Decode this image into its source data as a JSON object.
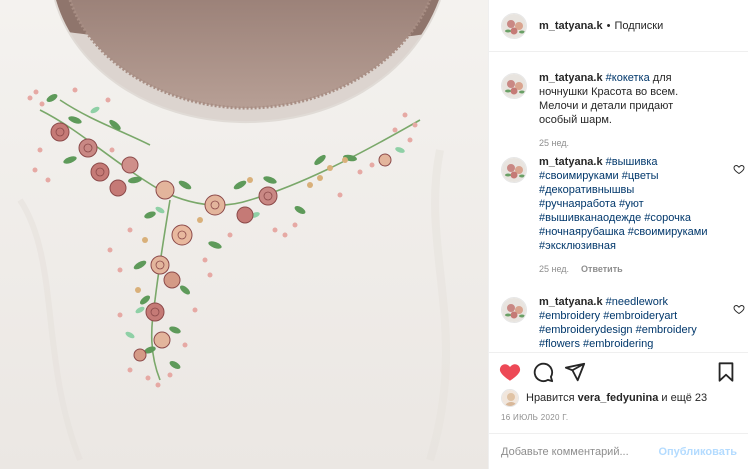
{
  "header": {
    "username": "m_tatyana.k",
    "separator": "•",
    "follow_label": "Подписки"
  },
  "caption": {
    "username": "m_tatyana.k",
    "hashtag": "#кокетка",
    "text": " для ночнушки Красота во всем. Мелочи и детали придают особый шарм.",
    "time": "25 нед."
  },
  "comments": [
    {
      "username": "m_tatyana.k",
      "tags": "#вышивка #своимируками #цветы #декоративнышвы #ручнаяработа #уют #вышивканаодежде #сорочка #ночнаярубашка #своимируками #эксклюзивная",
      "time": "25 нед.",
      "reply_label": "Ответить"
    },
    {
      "username": "m_tatyana.k",
      "tags": "#needlework #embroidery #embroideryart #embroiderydesign #embroidery #flowers #embroidering"
    }
  ],
  "likes": {
    "prefix": "Нравится ",
    "user": "vera_fedyunina",
    "suffix": " и ещё 23"
  },
  "date": "16 ИЮЛЬ 2020 Г.",
  "add_comment": {
    "placeholder": "Добавьте комментарий...",
    "publish_label": "Опубликовать"
  },
  "icons": {
    "like": "heart-filled-icon",
    "comment": "speech-bubble-icon",
    "share": "paper-plane-icon",
    "save": "bookmark-icon"
  },
  "colors": {
    "like": "#ed4956",
    "link": "#00376b",
    "publish": "#b3dbff"
  }
}
